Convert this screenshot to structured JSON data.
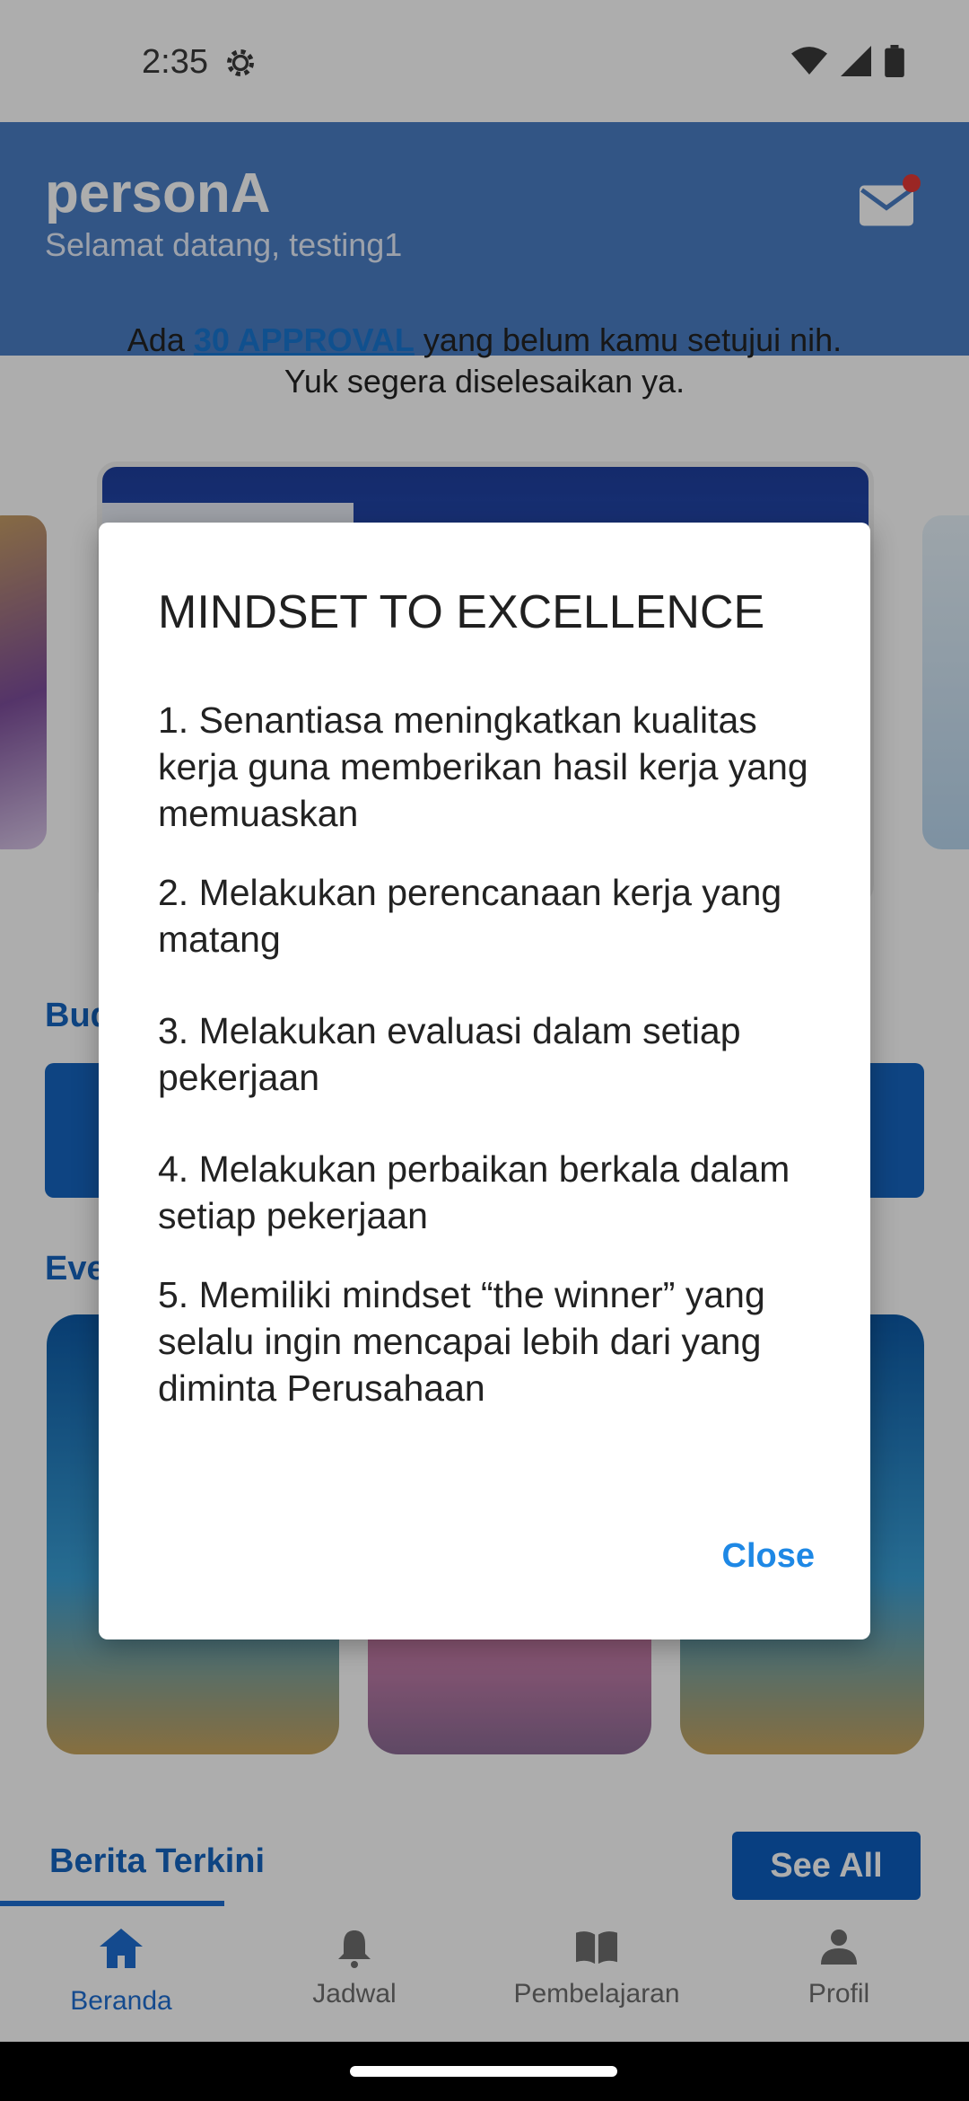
{
  "status_bar": {
    "time": "2:35"
  },
  "header": {
    "title": "personA",
    "subtitle": "Selamat datang, testing1"
  },
  "approval": {
    "prefix": "Ada ",
    "link": "30 APPROVAL",
    "suffix": " yang belum kamu setujui nih. Yuk segera diselesaikan ya."
  },
  "sections": {
    "budaya_title": "Bud",
    "event_title": "Eve"
  },
  "berita": {
    "tab_label": "Berita Terkini",
    "see_all_label": "See All"
  },
  "bottom_nav": {
    "items": [
      {
        "label": "Beranda",
        "icon": "home-icon",
        "active": true
      },
      {
        "label": "Jadwal",
        "icon": "bell-icon",
        "active": false
      },
      {
        "label": "Pembelajaran",
        "icon": "book-icon",
        "active": false
      },
      {
        "label": "Profil",
        "icon": "person-icon",
        "active": false
      }
    ]
  },
  "dialog": {
    "title": "MINDSET TO EXCELLENCE",
    "items": [
      "1. Senantiasa meningkatkan kualitas kerja guna memberikan hasil kerja yang memuaskan",
      "2. Melakukan perencanaan kerja yang matang",
      "3. Melakukan evaluasi dalam setiap pekerjaan",
      "4. Melakukan perbaikan berkala dalam setiap pekerjaan",
      "5. Memiliki mindset “the winner” yang selalu ingin mencapai lebih dari yang diminta Perusahaan"
    ],
    "close_label": "Close"
  },
  "colors": {
    "accent": "#1565c0",
    "dialog_action": "#1e88e5",
    "notification_dot": "#e53935"
  }
}
